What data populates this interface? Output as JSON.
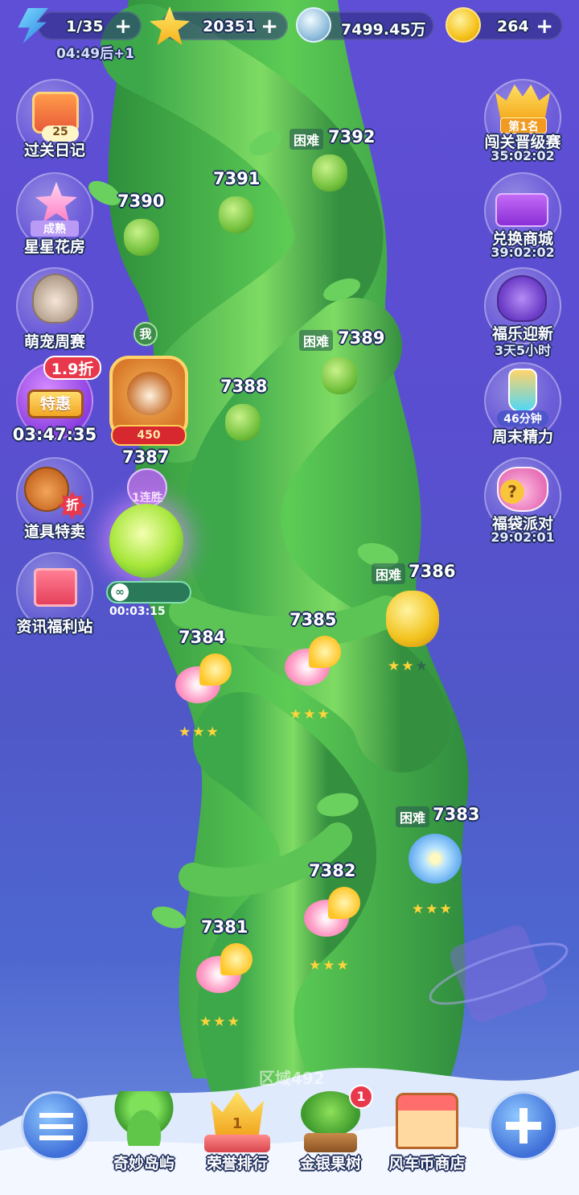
{
  "top_bar": {
    "energy": "1/35",
    "energy_timer": "04:49后+1",
    "stars": "20351",
    "silver": "7499.45万",
    "coins": "264",
    "plus": "+"
  },
  "left_buttons": [
    {
      "label": "过关日记",
      "badge": "25"
    },
    {
      "label": "星星花房",
      "badge": "成熟"
    },
    {
      "label": "萌宠周赛"
    },
    {
      "label": "特惠",
      "timer": "03:47:35",
      "discount": "1.9折"
    },
    {
      "label": "道具特卖",
      "tag": "折"
    },
    {
      "label": "资讯福利站"
    }
  ],
  "right_buttons": [
    {
      "label": "闯关晋级赛",
      "timer": "35:02:02",
      "badge": "第1名"
    },
    {
      "label": "兑换商城",
      "timer": "39:02:02"
    },
    {
      "label": "福乐迎新",
      "timer": "3天5小时"
    },
    {
      "label": "周末精力",
      "badge": "46分钟"
    },
    {
      "label": "福袋派对",
      "timer": "29:02:01"
    }
  ],
  "player": {
    "me_label": "我",
    "score": "450",
    "current_level": "7387",
    "streak": "1连胜",
    "boost_timer": "00:03:15",
    "infinity": "∞"
  },
  "levels": [
    {
      "num": "7392",
      "difficulty": "困难"
    },
    {
      "num": "7391"
    },
    {
      "num": "7390"
    },
    {
      "num": "7389",
      "difficulty": "困难"
    },
    {
      "num": "7388"
    },
    {
      "num": "7386",
      "difficulty": "困难",
      "stars_earned": 2
    },
    {
      "num": "7385",
      "stars_earned": 3
    },
    {
      "num": "7384",
      "stars_earned": 3
    },
    {
      "num": "7383",
      "difficulty": "困难",
      "stars_earned": 3
    },
    {
      "num": "7382",
      "stars_earned": 3
    },
    {
      "num": "7381",
      "stars_earned": 3
    }
  ],
  "area_label": "区域492",
  "bottom_nav": [
    {
      "label": "奇妙岛屿"
    },
    {
      "label": "荣誉排行",
      "rank": "1"
    },
    {
      "label": "金银果树",
      "badge": "1"
    },
    {
      "label": "风车币商店"
    }
  ],
  "colors": {
    "bg_top": "#5f4fd6",
    "bg_bottom": "#6f8fe0",
    "stalk": "#4fb84a",
    "gold": "#ffd43a",
    "badge_red": "#e8394c"
  }
}
